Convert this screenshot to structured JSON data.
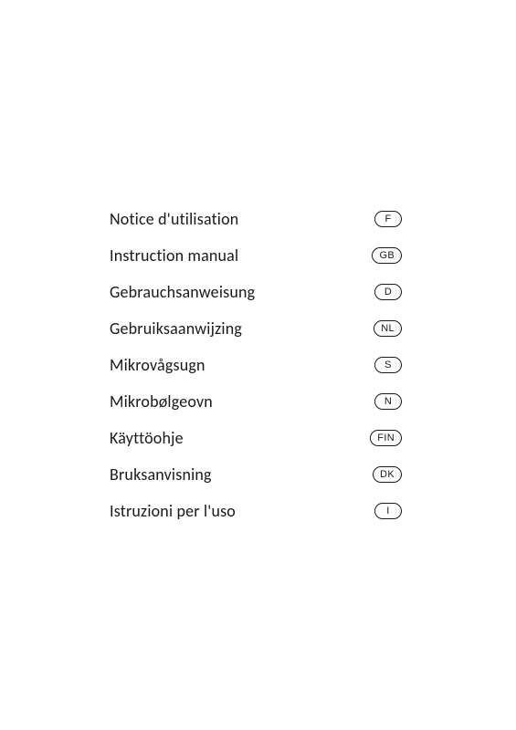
{
  "items": [
    {
      "label": "Notice d'utilisation",
      "badge": "F"
    },
    {
      "label": "Instruction manual",
      "badge": "GB"
    },
    {
      "label": "Gebrauchsanweisung",
      "badge": "D"
    },
    {
      "label": "Gebruiksaanwijzing",
      "badge": "NL"
    },
    {
      "label": "Mikrovågsugn",
      "badge": "S"
    },
    {
      "label": "Mikrobølgeovn",
      "badge": "N"
    },
    {
      "label": "Käyttöohje",
      "badge": "FIN"
    },
    {
      "label": "Bruksanvisning",
      "badge": "DK"
    },
    {
      "label": "Istruzioni per l'uso",
      "badge": "I"
    }
  ]
}
